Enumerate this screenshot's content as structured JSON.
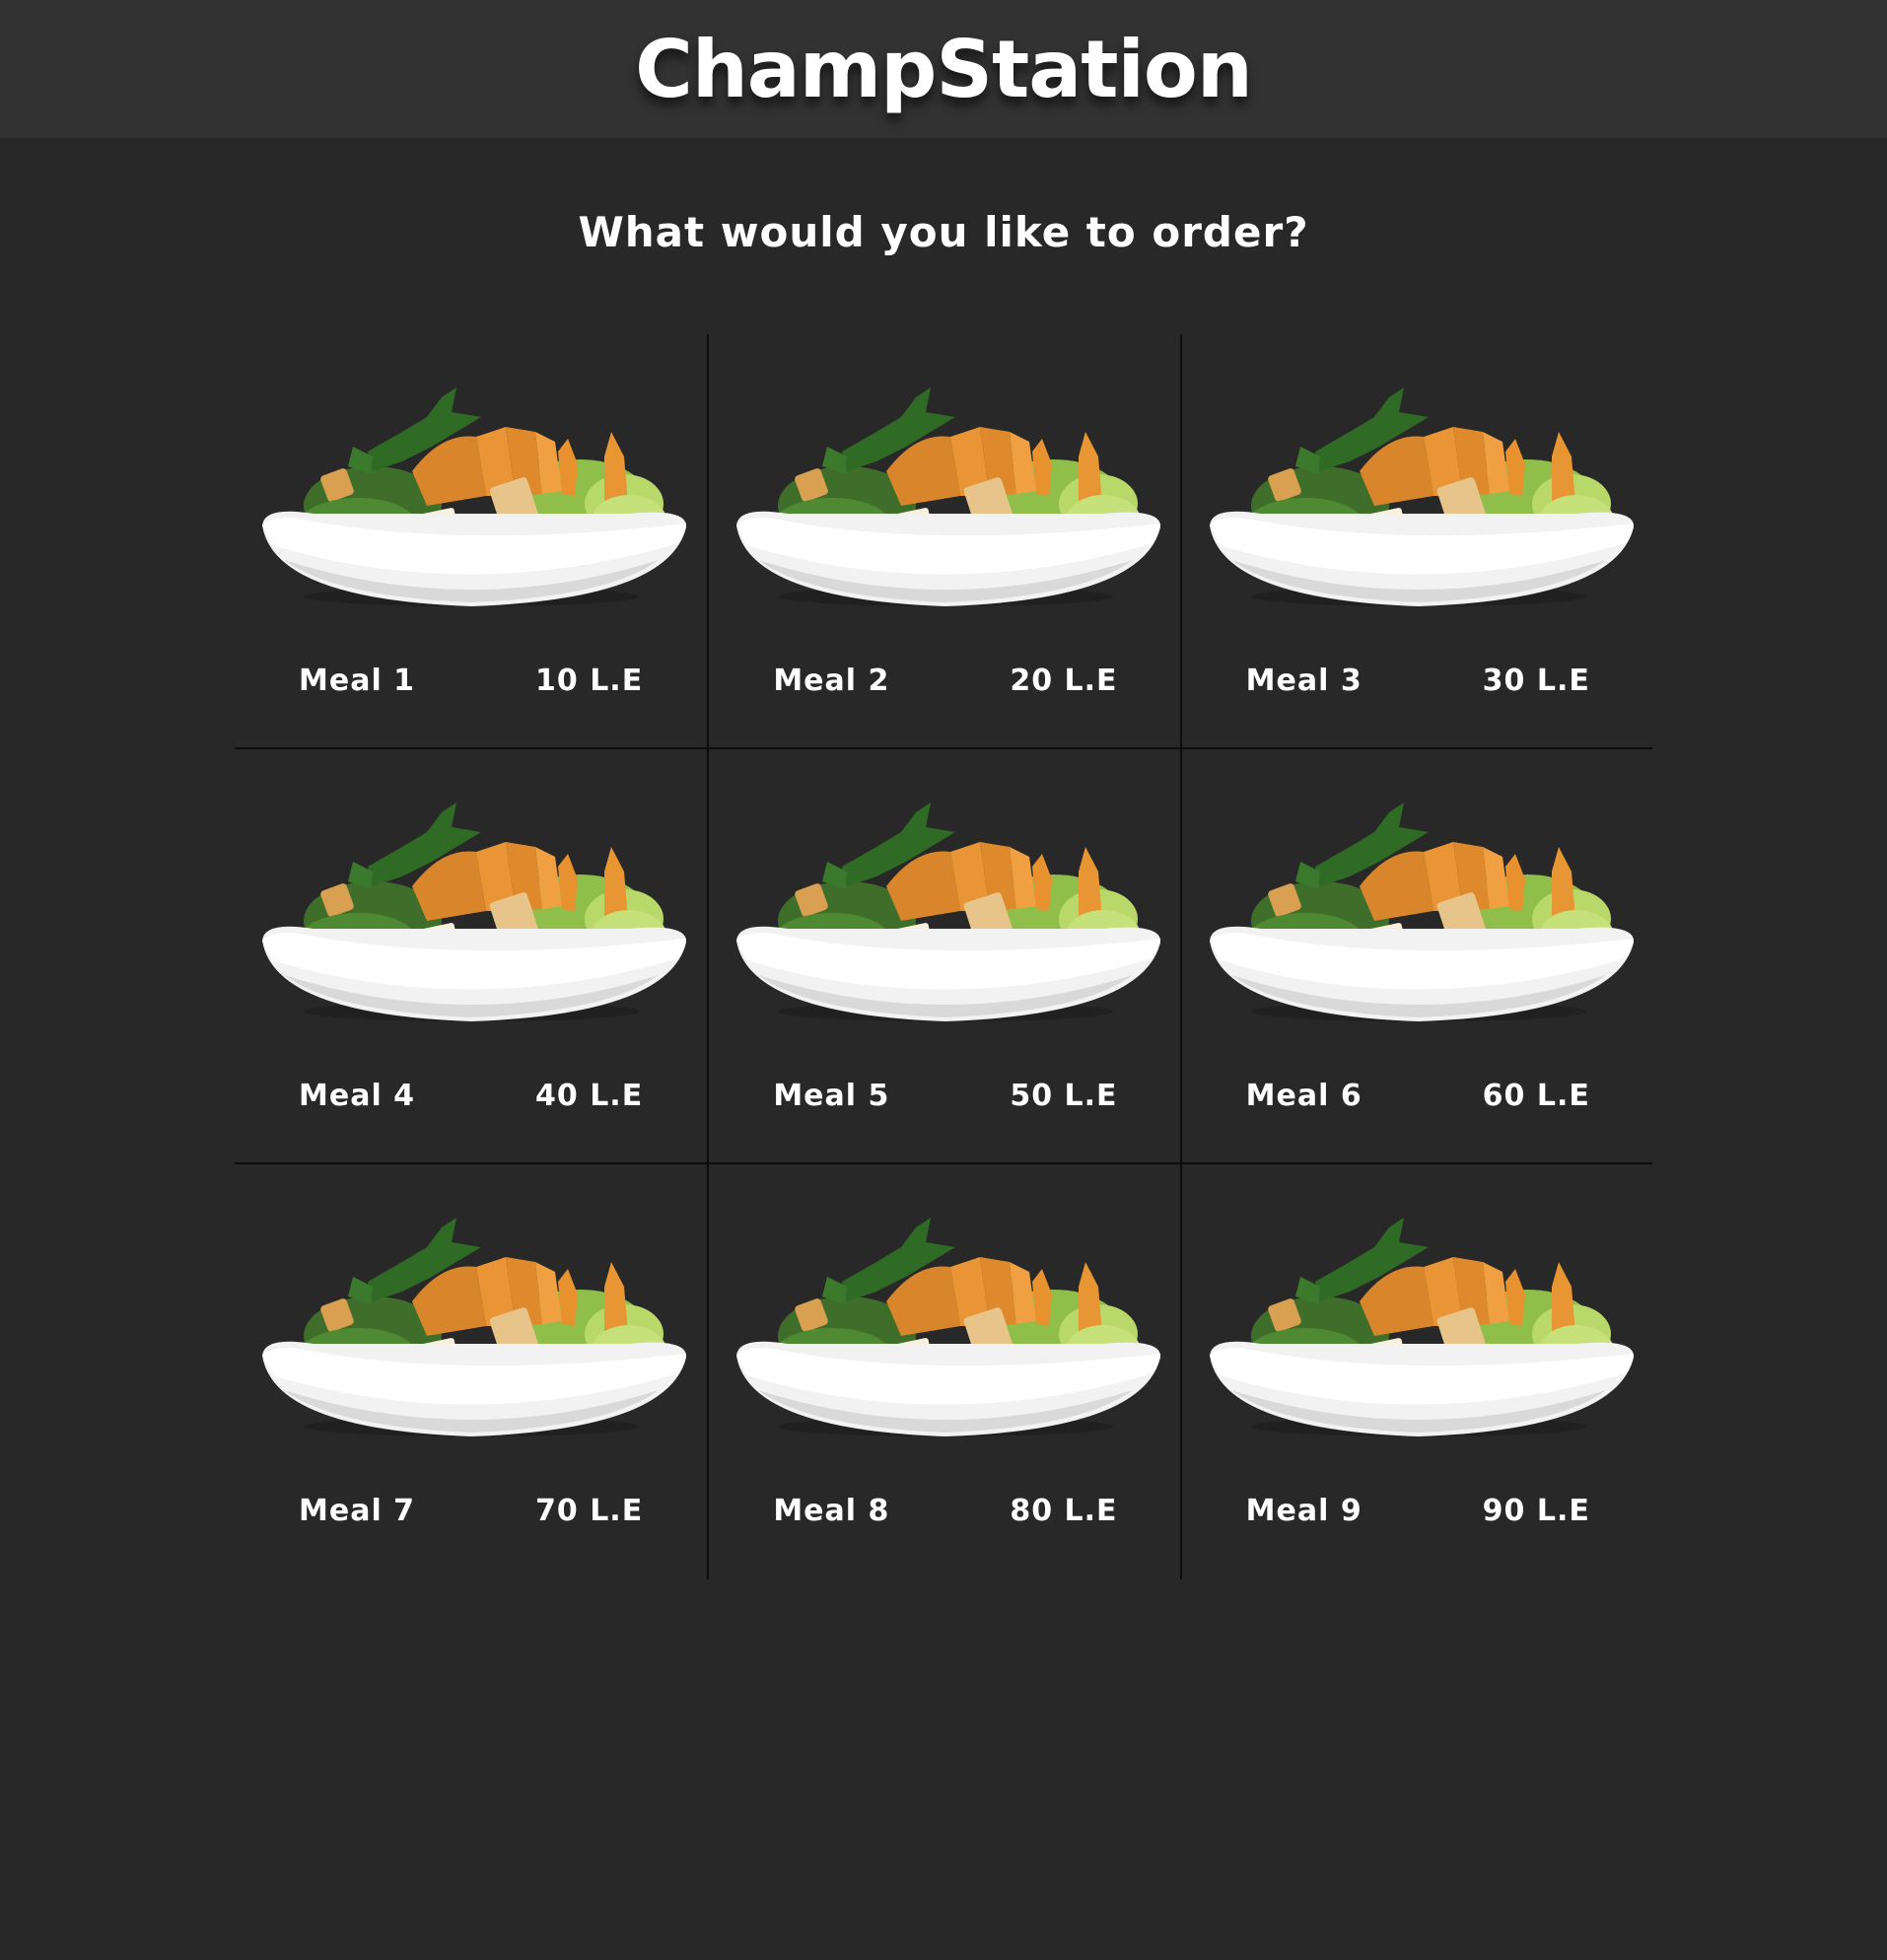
{
  "header": {
    "title": "ChampStation"
  },
  "prompt": "What would you like to order?",
  "colors": {
    "page_background": "#282828",
    "header_background": "#323232",
    "divider": "#0d0d0d",
    "text": "#ffffff"
  },
  "meals": [
    {
      "name": "Meal 1",
      "price": "10 L.E",
      "icon": "salad-bowl-image"
    },
    {
      "name": "Meal 2",
      "price": "20 L.E",
      "icon": "salad-bowl-image"
    },
    {
      "name": "Meal 3",
      "price": "30 L.E",
      "icon": "salad-bowl-image"
    },
    {
      "name": "Meal 4",
      "price": "40 L.E",
      "icon": "salad-bowl-image"
    },
    {
      "name": "Meal 5",
      "price": "50 L.E",
      "icon": "salad-bowl-image"
    },
    {
      "name": "Meal 6",
      "price": "60 L.E",
      "icon": "salad-bowl-image"
    },
    {
      "name": "Meal 7",
      "price": "70 L.E",
      "icon": "salad-bowl-image"
    },
    {
      "name": "Meal 8",
      "price": "80 L.E",
      "icon": "salad-bowl-image"
    },
    {
      "name": "Meal 9",
      "price": "90 L.E",
      "icon": "salad-bowl-image"
    }
  ]
}
